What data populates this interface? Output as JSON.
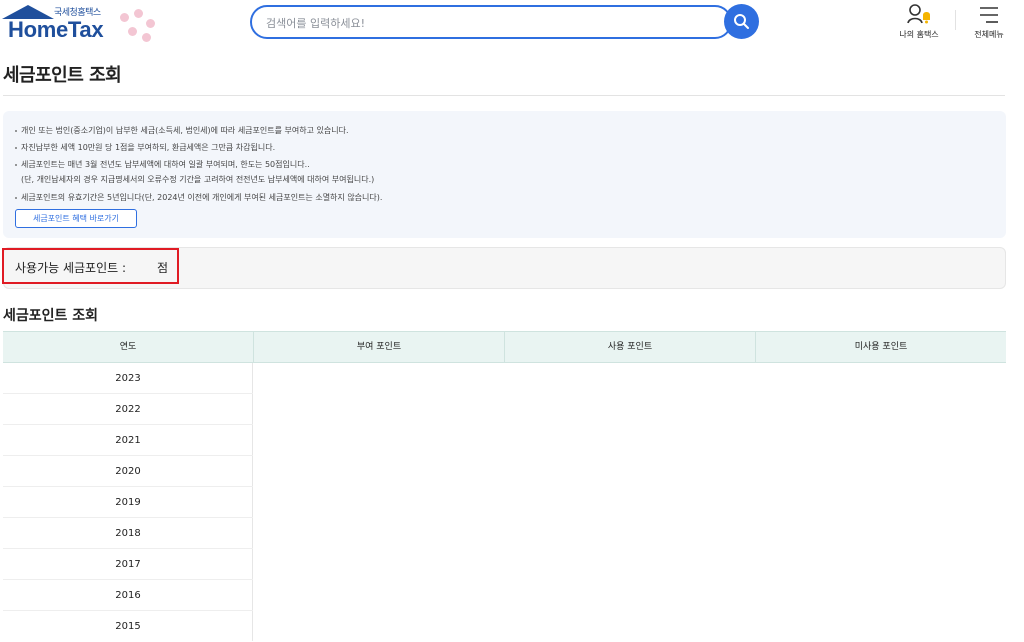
{
  "header": {
    "logo_sub": "국세청홈택스",
    "logo_main": "HomeTax",
    "search_placeholder": "검색어를 입력하세요!",
    "my_hometax_label": "나의 홈택스",
    "all_menu_label": "전체메뉴"
  },
  "page": {
    "title": "세금포인트 조회"
  },
  "info": {
    "lines": [
      "개인 또는 법인(중소기업)이 납부한 세금(소득세, 법인세)에 따라 세금포인트를 부여하고 있습니다.",
      "자진납부한 세액 10만원 당 1점을 부여하되, 환급세액은 그만큼 차감됩니다.",
      "세금포인트는 매년 3월 전년도 납부세액에 대하여 일괄 부여되며, 한도는 50점입니다..",
      "(단, 개인납세자의 경우 지급명세서의 오류수정 기간을 고려하여 전전년도 납부세액에 대하여 부여됩니다.)",
      "세금포인트의 유효기간은 5년입니다(단, 2024년 이전에 개인에게 부여된 세금포인트는 소멸하지 않습니다)."
    ],
    "benefit_button": "세금포인트 혜택 바로가기"
  },
  "points": {
    "label": "사용가능 세금포인트 :",
    "unit": "점"
  },
  "section": {
    "title": "세금포인트 조회"
  },
  "table": {
    "headers": [
      "연도",
      "부여 포인트",
      "사용 포인트",
      "미사용 포인트"
    ],
    "years": [
      "2023",
      "2022",
      "2021",
      "2020",
      "2019",
      "2018",
      "2017",
      "2016",
      "2015"
    ]
  },
  "colors": {
    "brand": "#1f4f9c",
    "accent": "#2f6fe0",
    "highlight": "#e01b24",
    "table_header_bg": "#e9f4f2"
  },
  "icons": {
    "search": "search-icon",
    "my_hometax": "user-bell-icon",
    "all_menu": "hamburger-icon"
  }
}
